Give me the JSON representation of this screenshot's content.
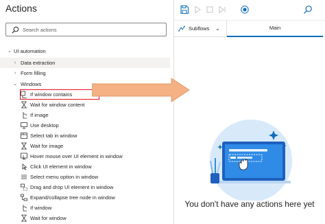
{
  "actions_pane": {
    "title": "Actions",
    "search": {
      "placeholder": "Search actions",
      "value": ""
    },
    "category": "UI automation",
    "groups": [
      "Data extraction",
      "Form filling",
      "Windows"
    ],
    "items": [
      {
        "label": "If window contains",
        "icon": "if-window-icon"
      },
      {
        "label": "Wait for window content",
        "icon": "wait-window-icon"
      },
      {
        "label": "If image",
        "icon": "if-image-icon"
      },
      {
        "label": "Use desktop",
        "icon": "desktop-icon"
      },
      {
        "label": "Select tab in window",
        "icon": "tab-icon"
      },
      {
        "label": "Wait for image",
        "icon": "wait-image-icon"
      },
      {
        "label": "Hover mouse over UI element in window",
        "icon": "hover-icon"
      },
      {
        "label": "Click UI element in window",
        "icon": "click-icon"
      },
      {
        "label": "Select menu option in window",
        "icon": "menu-icon"
      },
      {
        "label": "Drag and drop UI element in window",
        "icon": "drag-drop-icon"
      },
      {
        "label": "Expand/collapse tree node in window",
        "icon": "tree-node-icon"
      },
      {
        "label": "If window",
        "icon": "if-window-icon"
      },
      {
        "label": "Wait for window",
        "icon": "wait-window-icon"
      }
    ],
    "highlighted_item": "If window contains"
  },
  "designer": {
    "toolbar_icons": [
      "save-icon",
      "run-icon",
      "stop-icon",
      "step-icon",
      "record-icon",
      "search-icon"
    ],
    "subflows_label": "Subflows",
    "main_tab_label": "Main",
    "empty_message": "You don't have any actions here yet"
  },
  "colors": {
    "accent": "#0f6cbd",
    "highlight_border": "#e81123",
    "arrow_fill": "#f4b183",
    "arrow_stroke": "#e49a6a",
    "illustration_circle": "#d8eafa"
  }
}
